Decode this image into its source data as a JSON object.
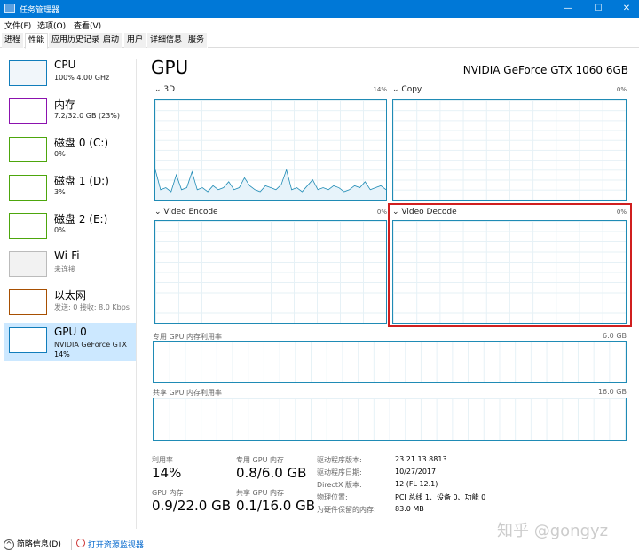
{
  "window": {
    "title": "任务管理器"
  },
  "menu": [
    "文件(F)",
    "选项(O)",
    "查看(V)"
  ],
  "tabs": [
    "进程",
    "性能",
    "应用历史记录",
    "启动",
    "用户",
    "详细信息",
    "服务"
  ],
  "sidebar": [
    {
      "name": "CPU",
      "sub": "100% 4.00 GHz",
      "color": "#117dbb"
    },
    {
      "name": "内存",
      "sub": "7.2/32.0 GB (23%)",
      "color": "#8b12ae"
    },
    {
      "name": "磁盘 0 (C:)",
      "sub": "0%",
      "color": "#4da60c"
    },
    {
      "name": "磁盘 1 (D:)",
      "sub": "3%",
      "color": "#4da60c"
    },
    {
      "name": "磁盘 2 (E:)",
      "sub": "0%",
      "color": "#4da60c"
    },
    {
      "name": "Wi-Fi",
      "sub": "未连接",
      "color": "#bbbbbb"
    },
    {
      "name": "以太网",
      "sub": "发送: 0 接收: 8.0 Kbps",
      "color": "#a74f01"
    },
    {
      "name": "GPU 0",
      "sub": "NVIDIA GeForce GTX",
      "sub2": "14%",
      "color": "#117dbb"
    }
  ],
  "main": {
    "title": "GPU",
    "device": "NVIDIA GeForce GTX 1060 6GB",
    "engines": [
      {
        "label": "3D",
        "pct": "14%",
        "history": [
          30,
          10,
          12,
          8,
          25,
          10,
          12,
          28,
          10,
          12,
          8,
          14,
          10,
          12,
          18,
          10,
          12,
          22,
          14,
          10,
          8,
          14,
          12,
          10,
          15,
          30,
          10,
          12,
          8,
          14,
          20,
          10,
          12,
          10,
          14,
          12,
          8,
          10,
          14,
          12,
          18,
          10,
          12,
          14,
          10
        ]
      },
      {
        "label": "Copy",
        "pct": "0%"
      },
      {
        "label": "Video Encode",
        "pct": "0%"
      },
      {
        "label": "Video Decode",
        "pct": "0%"
      }
    ],
    "dedicated": {
      "label": "专用 GPU 内存利用率",
      "max": "6.0 GB"
    },
    "shared": {
      "label": "共享 GPU 内存利用率",
      "max": "16.0 GB"
    },
    "stats": [
      {
        "label": "利用率",
        "value": "14%"
      },
      {
        "label": "专用 GPU 内存",
        "value": "0.8/6.0 GB"
      },
      {
        "label": "GPU 内存",
        "value": "0.9/22.0 GB"
      },
      {
        "label": "共享 GPU 内存",
        "value": "0.1/16.0 GB"
      }
    ],
    "props": [
      {
        "k": "驱动程序版本:",
        "v": "23.21.13.8813"
      },
      {
        "k": "驱动程序日期:",
        "v": "10/27/2017"
      },
      {
        "k": "DirectX 版本:",
        "v": "12 (FL 12.1)"
      },
      {
        "k": "物理位置:",
        "v": "PCI 总线 1、设备 0、功能 0"
      },
      {
        "k": "为硬件保留的内存:",
        "v": "83.0 MB"
      }
    ]
  },
  "footer": {
    "less": "简略信息(D)",
    "monitor": "打开资源监视器"
  },
  "watermark": "知乎 @gongyz",
  "colors": {
    "accent": "#0078d7",
    "highlight": "#d01f1f"
  }
}
